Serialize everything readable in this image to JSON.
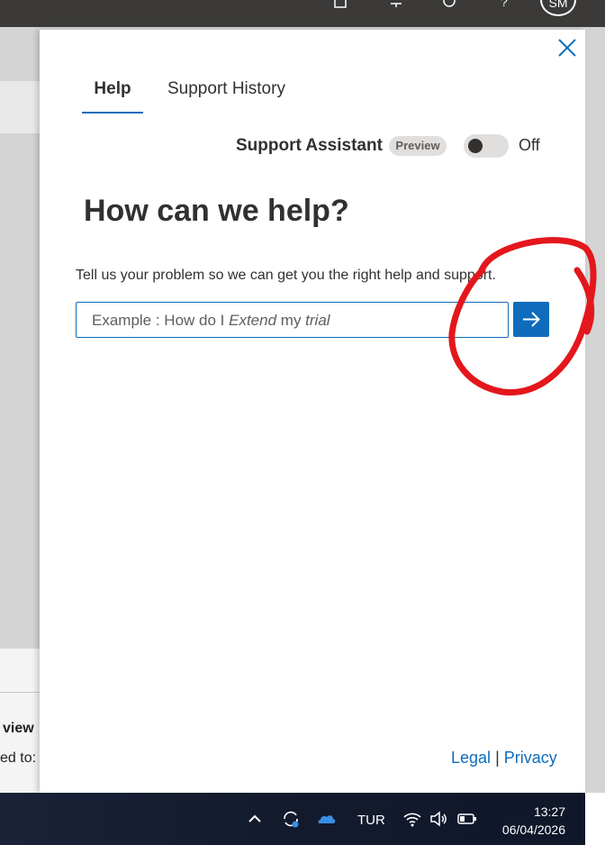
{
  "topbar": {
    "avatar_initials": "SM",
    "help_glyph": "?"
  },
  "background_page": {
    "text_view": "view",
    "text_shared": "ed to:"
  },
  "panel": {
    "close_label": "Close",
    "tabs": [
      {
        "label": "Help",
        "active": true
      },
      {
        "label": "Support History",
        "active": false
      }
    ],
    "assistant": {
      "label": "Support Assistant",
      "badge": "Preview",
      "toggle_state": "Off"
    },
    "headline": "How can we help?",
    "helper_text": "Tell us your problem so we can get you the right help and support.",
    "search": {
      "placeholder_prefix": "Example : How do I ",
      "placeholder_em1": "Extend",
      "placeholder_mid": " my ",
      "placeholder_em2": "trial"
    },
    "footer": {
      "legal": "Legal",
      "separator": "|",
      "privacy": "Privacy"
    }
  },
  "taskbar": {
    "language": "TUR",
    "time": "13:27",
    "date": "06/04/2026"
  },
  "colors": {
    "accent": "#0f6cbd",
    "annotation": "#e3171c",
    "taskbar": "#141b2e"
  }
}
